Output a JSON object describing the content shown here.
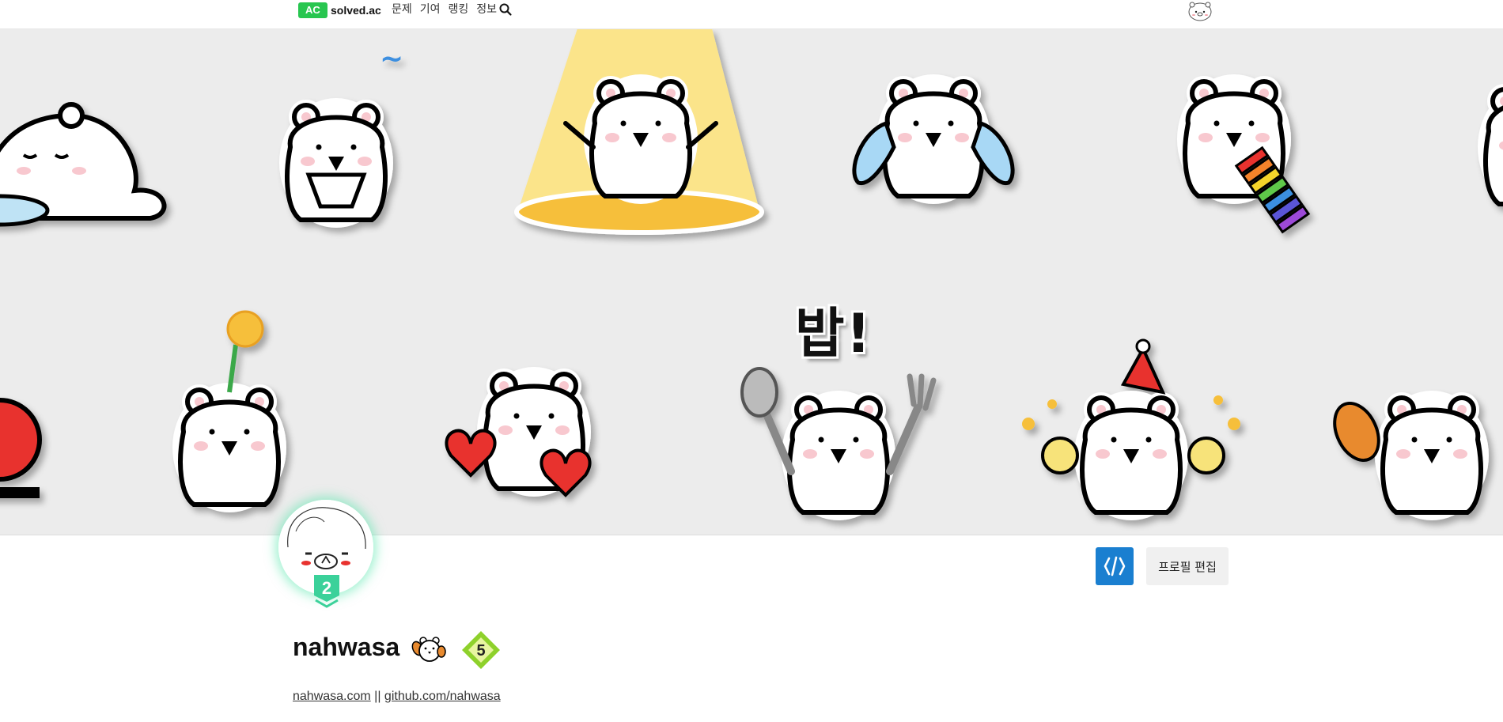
{
  "nav": {
    "logo_badge": "AC",
    "logo_text": "solved.ac",
    "links": [
      "문제",
      "기여",
      "랭킹",
      "정보"
    ],
    "search_icon": "search-icon",
    "avatar_icon": "bear-face-icon"
  },
  "banner": {
    "bap_text": "밥!"
  },
  "profile": {
    "level": "2",
    "code_button_icon": "code-brackets-icon",
    "edit_button_label": "프로필 편집",
    "username": "nahwasa",
    "class_badge": "5",
    "link_1": "nahwasa.com",
    "separator": " || ",
    "link_2": "github.com/nahwasa"
  },
  "colors": {
    "accent_green": "#28c650",
    "code_button_blue": "#1a7fd0",
    "banner_bg": "#ececec",
    "level_green": "#3bd19a"
  }
}
